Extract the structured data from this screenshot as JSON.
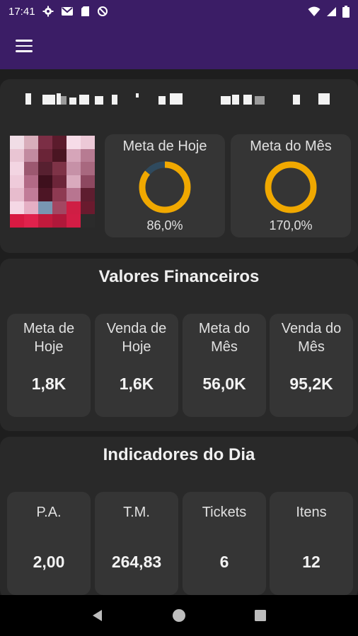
{
  "status_bar": {
    "time": "17:41",
    "icons_left": [
      "gear-icon",
      "gmail-icon",
      "sd-card-icon",
      "no-sign-icon"
    ],
    "icons_right": [
      "wifi-icon",
      "signal-icon",
      "battery-icon"
    ]
  },
  "app_bar": {
    "menu_icon": "hamburger-menu-icon"
  },
  "profile": {
    "name": "",
    "avatar": "pixelated-user-avatar",
    "goals": [
      {
        "title": "Meta de Hoje",
        "percent_text": "86,0%",
        "percent": 86.0,
        "color": "#f0a800",
        "track": "#2f4a5e"
      },
      {
        "title": "Meta do Mês",
        "percent_text": "170,0%",
        "percent": 170.0,
        "color": "#f0a800",
        "track": "#2f4a5e"
      }
    ]
  },
  "financial": {
    "title": "Valores Financeiros",
    "tiles": [
      {
        "label": "Meta de Hoje",
        "value": "1,8K"
      },
      {
        "label": "Venda de Hoje",
        "value": "1,6K"
      },
      {
        "label": "Meta do Mês",
        "value": "56,0K"
      },
      {
        "label": "Venda do Mês",
        "value": "95,2K"
      }
    ]
  },
  "indicators": {
    "title": "Indicadores do Dia",
    "tiles": [
      {
        "label": "P.A.",
        "value": "2,00"
      },
      {
        "label": "T.M.",
        "value": "264,83"
      },
      {
        "label": "Tickets",
        "value": "6"
      },
      {
        "label": "Itens",
        "value": "12"
      }
    ]
  },
  "nav_bar": {
    "buttons": [
      "back-icon",
      "home-icon",
      "recents-icon"
    ]
  },
  "colors": {
    "primary": "#3b1d66",
    "background": "#1e1e1e",
    "card": "#292929",
    "tile": "#353535",
    "accent": "#f0a800"
  }
}
